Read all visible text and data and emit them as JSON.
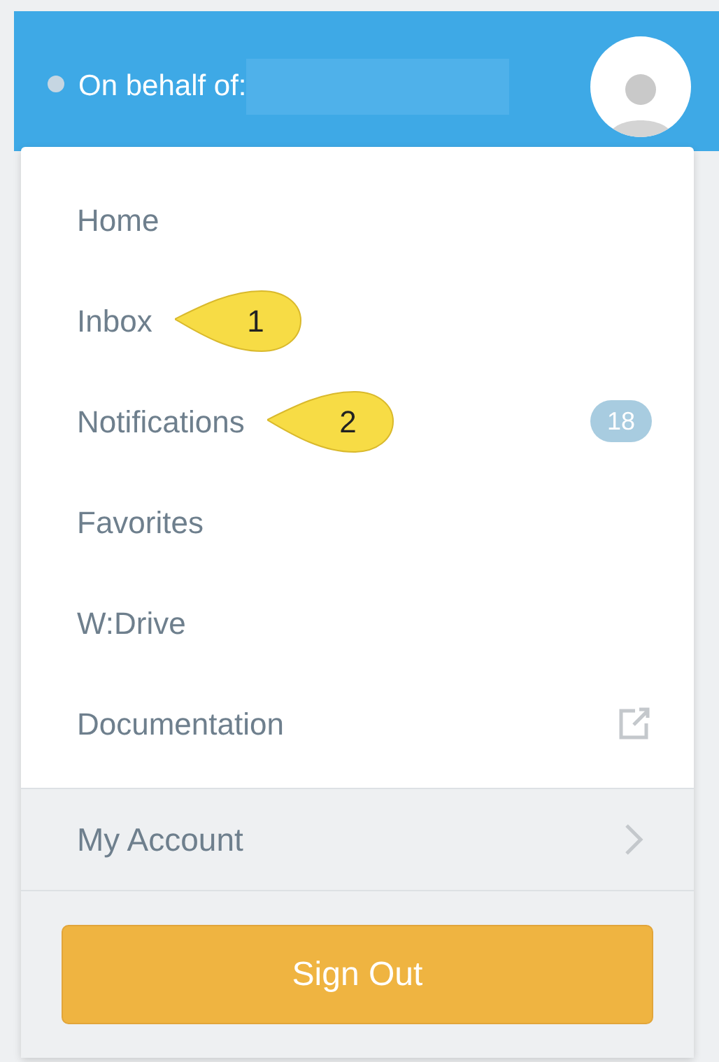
{
  "header": {
    "label": "On behalf of:"
  },
  "menu": {
    "items": [
      {
        "label": "Home",
        "kind": "plain"
      },
      {
        "label": "Inbox",
        "kind": "plain",
        "callout": "1"
      },
      {
        "label": "Notifications",
        "kind": "badge",
        "badge": "18",
        "callout": "2"
      },
      {
        "label": "Favorites",
        "kind": "plain"
      },
      {
        "label": "W:Drive",
        "kind": "plain"
      },
      {
        "label": "Documentation",
        "kind": "external"
      }
    ],
    "account": {
      "label": "My Account"
    },
    "sign_out": {
      "label": "Sign Out"
    }
  }
}
